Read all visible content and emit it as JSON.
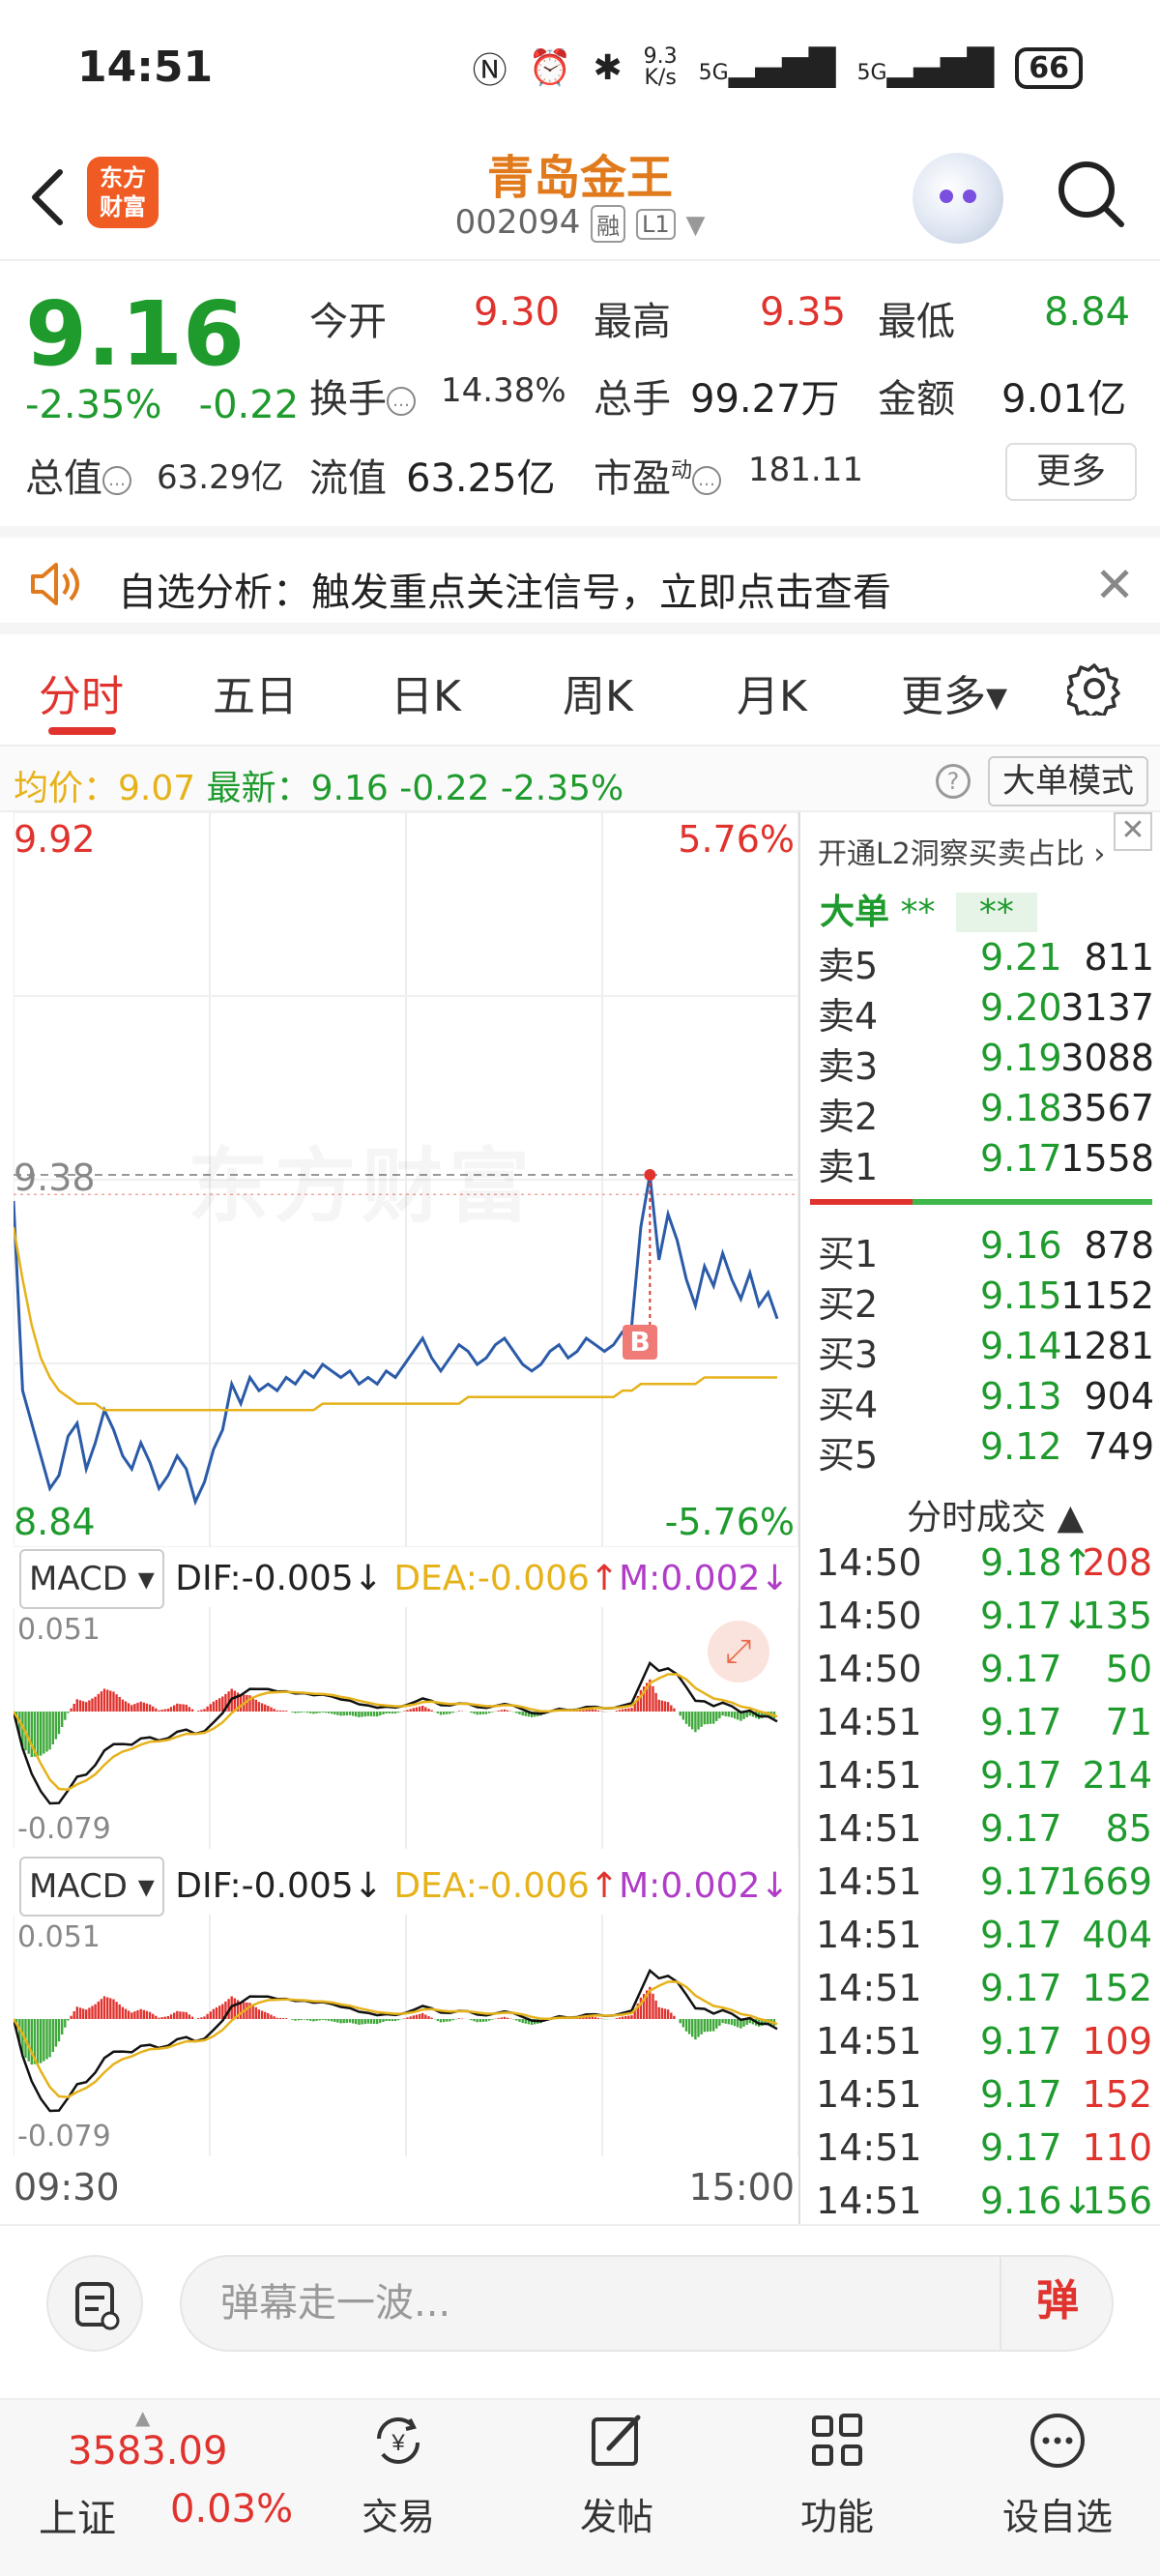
{
  "status_bar": {
    "time": "14:51",
    "net_speed_top": "9.3",
    "net_speed_unit": "K/s",
    "signal1": "5G",
    "signal2": "5G",
    "battery": "66"
  },
  "header": {
    "logo_text_line1": "东方",
    "logo_text_line2": "财富",
    "stock_name": "青岛金王",
    "stock_code": "002094",
    "tag_margin": "融",
    "tag_level": "L1"
  },
  "quote": {
    "price": "9.16",
    "change_pct": "-2.35%",
    "change_abs": "-0.22",
    "open_label": "今开",
    "open_value": "9.30",
    "high_label": "最高",
    "high_value": "9.35",
    "low_label": "最低",
    "low_value": "8.84",
    "turnover_label": "换手",
    "turnover_value": "14.38%",
    "volume_label": "总手",
    "volume_value": "99.27万",
    "amount_label": "金额",
    "amount_value": "9.01亿",
    "mktcap_label": "总值",
    "mktcap_value": "63.29亿",
    "float_label": "流值",
    "float_value": "63.25亿",
    "pe_label": "市盈",
    "pe_sup": "动",
    "pe_value": "181.11",
    "more_label": "更多"
  },
  "banner": {
    "text": "自选分析：触发重点关注信号，立即点击查看"
  },
  "tabs": [
    {
      "label": "分时",
      "active": true
    },
    {
      "label": "五日"
    },
    {
      "label": "日K"
    },
    {
      "label": "周K"
    },
    {
      "label": "月K"
    },
    {
      "label": "更多▾"
    }
  ],
  "avg_line": {
    "avg_label": "均价：",
    "avg_value": "9.07",
    "latest_label": "最新：",
    "latest_value": "9.16",
    "change_abs": "-0.22",
    "change_pct": "-2.35%",
    "help": "?",
    "big_order_mode": "大单模式"
  },
  "chart_data": {
    "type": "line",
    "y_max": "9.92",
    "y_max_pct": "5.76%",
    "y_min": "8.84",
    "y_min_pct": "-5.76%",
    "prev_close": "9.38",
    "x_start": "09:30",
    "x_end": "15:00",
    "watermark": "东方财富",
    "marker": "B",
    "ylim": [
      8.84,
      9.92
    ],
    "series": [
      {
        "values": [
          9.34,
          9.05,
          9.0,
          8.95,
          8.9,
          8.92,
          8.98,
          9.0,
          8.93,
          8.97,
          9.02,
          8.99,
          8.95,
          8.93,
          8.97,
          8.94,
          8.9,
          8.92,
          8.95,
          8.93,
          8.88,
          8.91,
          8.96,
          8.99,
          9.06,
          9.03,
          9.07,
          9.05,
          9.06,
          9.05,
          9.07,
          9.06,
          9.08,
          9.07,
          9.09,
          9.08,
          9.07,
          9.08,
          9.06,
          9.07,
          9.06,
          9.08,
          9.07,
          9.09,
          9.11,
          9.13,
          9.1,
          9.08,
          9.1,
          9.12,
          9.11,
          9.09,
          9.1,
          9.12,
          9.13,
          9.11,
          9.09,
          9.08,
          9.09,
          9.11,
          9.12,
          9.1,
          9.11,
          9.13,
          9.12,
          9.11,
          9.12,
          9.14,
          9.15,
          9.3,
          9.38,
          9.25,
          9.32,
          9.28,
          9.22,
          9.18,
          9.24,
          9.21,
          9.26,
          9.22,
          9.19,
          9.23,
          9.18,
          9.2,
          9.16
        ]
      },
      {
        "values": [
          9.3,
          9.22,
          9.15,
          9.1,
          9.07,
          9.05,
          9.04,
          9.03,
          9.03,
          9.03,
          9.02,
          9.02,
          9.02,
          9.02,
          9.02,
          9.02,
          9.02,
          9.02,
          9.02,
          9.02,
          9.02,
          9.02,
          9.02,
          9.02,
          9.02,
          9.02,
          9.02,
          9.02,
          9.02,
          9.02,
          9.02,
          9.02,
          9.02,
          9.02,
          9.03,
          9.03,
          9.03,
          9.03,
          9.03,
          9.03,
          9.03,
          9.03,
          9.03,
          9.03,
          9.03,
          9.03,
          9.03,
          9.03,
          9.03,
          9.03,
          9.04,
          9.04,
          9.04,
          9.04,
          9.04,
          9.04,
          9.04,
          9.04,
          9.04,
          9.04,
          9.04,
          9.04,
          9.04,
          9.04,
          9.04,
          9.04,
          9.04,
          9.05,
          9.05,
          9.06,
          9.06,
          9.06,
          9.06,
          9.06,
          9.06,
          9.06,
          9.07,
          9.07,
          9.07,
          9.07,
          9.07,
          9.07,
          9.07,
          9.07,
          9.07
        ]
      }
    ]
  },
  "macd": [
    {
      "name": "MACD",
      "dif": "DIF:-0.005",
      "dea": "DEA:-0.006",
      "m": "M:0.002",
      "top": "0.051",
      "bottom": "-0.079"
    },
    {
      "name": "MACD",
      "dif": "DIF:-0.005",
      "dea": "DEA:-0.006",
      "m": "M:0.002",
      "top": "0.051",
      "bottom": "-0.079"
    }
  ],
  "panel": {
    "l2_link": "开通L2洞察买卖占比 ›",
    "big_order_label": "大单",
    "big_order_val1": "**",
    "big_order_val2": "**",
    "asks": [
      {
        "label": "卖5",
        "price": "9.21",
        "vol": "811"
      },
      {
        "label": "卖4",
        "price": "9.20",
        "vol": "3137"
      },
      {
        "label": "卖3",
        "price": "9.19",
        "vol": "3088"
      },
      {
        "label": "卖2",
        "price": "9.18",
        "vol": "3567"
      },
      {
        "label": "卖1",
        "price": "9.17",
        "vol": "1558"
      }
    ],
    "bids": [
      {
        "label": "买1",
        "price": "9.16",
        "vol": "878"
      },
      {
        "label": "买2",
        "price": "9.15",
        "vol": "1152"
      },
      {
        "label": "买3",
        "price": "9.14",
        "vol": "1281"
      },
      {
        "label": "买4",
        "price": "9.13",
        "vol": "904"
      },
      {
        "label": "买5",
        "price": "9.12",
        "vol": "749"
      }
    ],
    "trades_title": "分时成交 ▲",
    "trades": [
      {
        "time": "14:50",
        "price": "9.18↑",
        "vol": "208",
        "side": "buy"
      },
      {
        "time": "14:50",
        "price": "9.17↓",
        "vol": "135",
        "side": "sell"
      },
      {
        "time": "14:50",
        "price": "9.17",
        "vol": "50",
        "side": "sell"
      },
      {
        "time": "14:51",
        "price": "9.17",
        "vol": "71",
        "side": "sell"
      },
      {
        "time": "14:51",
        "price": "9.17",
        "vol": "214",
        "side": "sell"
      },
      {
        "time": "14:51",
        "price": "9.17",
        "vol": "85",
        "side": "sell"
      },
      {
        "time": "14:51",
        "price": "9.17",
        "vol": "1669",
        "side": "sell"
      },
      {
        "time": "14:51",
        "price": "9.17",
        "vol": "404",
        "side": "sell"
      },
      {
        "time": "14:51",
        "price": "9.17",
        "vol": "152",
        "side": "sell"
      },
      {
        "time": "14:51",
        "price": "9.17",
        "vol": "109",
        "side": "buy"
      },
      {
        "time": "14:51",
        "price": "9.17",
        "vol": "152",
        "side": "buy"
      },
      {
        "time": "14:51",
        "price": "9.17",
        "vol": "110",
        "side": "buy"
      },
      {
        "time": "14:51",
        "price": "9.16↓",
        "vol": "156",
        "side": "sell"
      }
    ]
  },
  "comment": {
    "placeholder": "弹幕走一波...",
    "danmu": "弹"
  },
  "bottom_nav": {
    "index_value": "3583.09",
    "index_name": "上证",
    "index_pct": "0.03%",
    "items": [
      {
        "label": "交易",
        "icon": "yen-exchange-icon"
      },
      {
        "label": "发帖",
        "icon": "edit-post-icon"
      },
      {
        "label": "功能",
        "icon": "grid-icon"
      },
      {
        "label": "设自选",
        "icon": "more-dots-icon"
      }
    ]
  },
  "colors": {
    "up": "#e0332e",
    "down": "#1f9b2e",
    "avg": "#e6b21a",
    "price_line": "#2b5ba8",
    "brand": "#f05a23"
  }
}
